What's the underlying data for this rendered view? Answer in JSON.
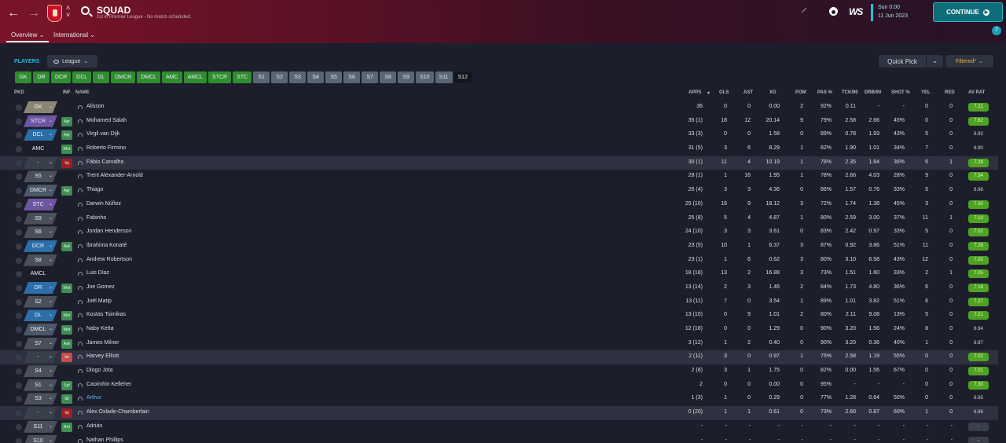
{
  "header": {
    "title": "SQUAD",
    "subtitle": "1st in Premier League - No match scheduled.",
    "tabs": [
      "Overview",
      "International"
    ],
    "date_time": "Sun 0:00",
    "date": "11 Jun 2023",
    "continue_label": "CONTINUE",
    "inbox_count": "7"
  },
  "toolbar": {
    "section_label": "PLAYERS",
    "view_label": "League",
    "quick_pick_label": "Quick Pick",
    "filter_label": "Filtered*"
  },
  "position_chips": [
    {
      "label": "GK",
      "state": "filled"
    },
    {
      "label": "DR",
      "state": "filled"
    },
    {
      "label": "DCR",
      "state": "filled"
    },
    {
      "label": "DCL",
      "state": "filled"
    },
    {
      "label": "DL",
      "state": "filled"
    },
    {
      "label": "DMCR",
      "state": "filled"
    },
    {
      "label": "DMCL",
      "state": "filled"
    },
    {
      "label": "AMC",
      "state": "filled"
    },
    {
      "label": "AMCL",
      "state": "filled"
    },
    {
      "label": "STCR",
      "state": "filled"
    },
    {
      "label": "STC",
      "state": "filled"
    },
    {
      "label": "S1",
      "state": "sub"
    },
    {
      "label": "S2",
      "state": "sub"
    },
    {
      "label": "S3",
      "state": "sub"
    },
    {
      "label": "S4",
      "state": "sub"
    },
    {
      "label": "S5",
      "state": "sub"
    },
    {
      "label": "S6",
      "state": "sub"
    },
    {
      "label": "S7",
      "state": "sub"
    },
    {
      "label": "S8",
      "state": "sub"
    },
    {
      "label": "S9",
      "state": "sub"
    },
    {
      "label": "S10",
      "state": "sub"
    },
    {
      "label": "S11",
      "state": "sub"
    },
    {
      "label": "S12",
      "state": "empty"
    }
  ],
  "columns": [
    "PKD",
    "INF",
    "NAME",
    "APPS",
    "GLS",
    "AST",
    "XG",
    "POM",
    "PAS %",
    "TCK/90",
    "DRB/90",
    "SHOT %",
    "YEL",
    "RED",
    "AV RAT"
  ],
  "players": [
    {
      "pos": "GK",
      "pos_style": "GK",
      "inf": "",
      "inf_style": "",
      "name": "Alisson",
      "apps": "36",
      "gls": "0",
      "ast": "0",
      "xg": "0.00",
      "pom": "2",
      "pas": "92%",
      "tck": "0.11",
      "drb": "-",
      "shot": "-",
      "yel": "0",
      "red": "0",
      "rat": "7.21",
      "rat_style": "hi",
      "hl": false,
      "link": false
    },
    {
      "pos": "STCR",
      "pos_style": "FWD",
      "inf": "Agr",
      "inf_style": "g",
      "name": "Mohamed Salah",
      "apps": "35 (1)",
      "gls": "18",
      "ast": "12",
      "xg": "20.14",
      "pom": "9",
      "pas": "79%",
      "tck": "2.58",
      "drb": "2.66",
      "shot": "45%",
      "yel": "0",
      "red": "0",
      "rat": "7.62",
      "rat_style": "hi",
      "hl": false,
      "link": false
    },
    {
      "pos": "DCL",
      "pos_style": "DEF",
      "inf": "Agr",
      "inf_style": "g",
      "name": "Virgil van Dijk",
      "apps": "33 (3)",
      "gls": "0",
      "ast": "0",
      "xg": "1.58",
      "pom": "0",
      "pas": "89%",
      "tck": "0.78",
      "drb": "1.93",
      "shot": "43%",
      "yel": "5",
      "red": "0",
      "rat": "6.92",
      "rat_style": "mid",
      "hl": false,
      "link": false
    },
    {
      "pos": "AMC",
      "pos_style": "AMCBLANK",
      "inf": "Wnt",
      "inf_style": "g",
      "name": "Roberto Firmino",
      "apps": "31 (5)",
      "gls": "3",
      "ast": "6",
      "xg": "8.29",
      "pom": "1",
      "pas": "82%",
      "tck": "1.90",
      "drb": "1.01",
      "shot": "34%",
      "yel": "7",
      "red": "0",
      "rat": "6.90",
      "rat_style": "mid",
      "hl": false,
      "link": false
    },
    {
      "pos": "-",
      "pos_style": "NONE",
      "inf": "Inj",
      "inf_style": "r",
      "name": "Fábio Carvalho",
      "apps": "30 (1)",
      "gls": "11",
      "ast": "4",
      "xg": "10.19",
      "pom": "1",
      "pas": "78%",
      "tck": "2.35",
      "drb": "1.84",
      "shot": "36%",
      "yel": "6",
      "red": "1",
      "rat": "7.28",
      "rat_style": "hi",
      "hl": true,
      "link": false
    },
    {
      "pos": "S5",
      "pos_style": "SUB",
      "inf": "",
      "inf_style": "",
      "name": "Trent Alexander-Arnold",
      "apps": "28 (1)",
      "gls": "1",
      "ast": "16",
      "xg": "1.95",
      "pom": "1",
      "pas": "78%",
      "tck": "2.66",
      "drb": "4.03",
      "shot": "28%",
      "yel": "9",
      "red": "0",
      "rat": "7.34",
      "rat_style": "hi",
      "hl": false,
      "link": false
    },
    {
      "pos": "DMCR",
      "pos_style": "DM",
      "inf": "Agr",
      "inf_style": "g",
      "name": "Thiago",
      "apps": "26 (4)",
      "gls": "3",
      "ast": "3",
      "xg": "4.36",
      "pom": "0",
      "pas": "86%",
      "tck": "1.57",
      "drb": "0.76",
      "shot": "33%",
      "yel": "5",
      "red": "0",
      "rat": "6.98",
      "rat_style": "mid",
      "hl": false,
      "link": false
    },
    {
      "pos": "STC",
      "pos_style": "FWD",
      "inf": "",
      "inf_style": "",
      "name": "Darwin Núñez",
      "apps": "25 (10)",
      "gls": "16",
      "ast": "9",
      "xg": "18.12",
      "pom": "3",
      "pas": "72%",
      "tck": "1.74",
      "drb": "1.38",
      "shot": "45%",
      "yel": "3",
      "red": "0",
      "rat": "7.30",
      "rat_style": "hi",
      "hl": false,
      "link": false
    },
    {
      "pos": "S9",
      "pos_style": "SUB",
      "inf": "",
      "inf_style": "",
      "name": "Fabinho",
      "apps": "25 (8)",
      "gls": "5",
      "ast": "4",
      "xg": "4.87",
      "pom": "1",
      "pas": "80%",
      "tck": "2.59",
      "drb": "3.00",
      "shot": "37%",
      "yel": "11",
      "red": "1",
      "rat": "7.10",
      "rat_style": "hi",
      "hl": false,
      "link": false
    },
    {
      "pos": "S6",
      "pos_style": "SUB",
      "inf": "",
      "inf_style": "",
      "name": "Jordan Henderson",
      "apps": "24 (10)",
      "gls": "3",
      "ast": "3",
      "xg": "3.61",
      "pom": "0",
      "pas": "83%",
      "tck": "2.42",
      "drb": "0.97",
      "shot": "33%",
      "yel": "5",
      "red": "0",
      "rat": "7.02",
      "rat_style": "hi",
      "hl": false,
      "link": false
    },
    {
      "pos": "DCR",
      "pos_style": "DEF",
      "inf": "Ask",
      "inf_style": "g",
      "name": "Ibrahima Konaté",
      "apps": "23 (5)",
      "gls": "10",
      "ast": "1",
      "xg": "6.37",
      "pom": "3",
      "pas": "87%",
      "tck": "0.92",
      "drb": "3.86",
      "shot": "51%",
      "yel": "11",
      "red": "0",
      "rat": "7.26",
      "rat_style": "hi",
      "hl": false,
      "link": false
    },
    {
      "pos": "S8",
      "pos_style": "SUB",
      "inf": "",
      "inf_style": "",
      "name": "Andrew Robertson",
      "apps": "23 (1)",
      "gls": "1",
      "ast": "6",
      "xg": "0.62",
      "pom": "3",
      "pas": "80%",
      "tck": "3.10",
      "drb": "6.58",
      "shot": "43%",
      "yel": "12",
      "red": "0",
      "rat": "7.20",
      "rat_style": "hi",
      "hl": false,
      "link": false
    },
    {
      "pos": "AMCL",
      "pos_style": "AMCBLANK",
      "inf": "",
      "inf_style": "",
      "name": "Luis Díaz",
      "apps": "18 (18)",
      "gls": "13",
      "ast": "2",
      "xg": "16.88",
      "pom": "3",
      "pas": "73%",
      "tck": "1.51",
      "drb": "1.60",
      "shot": "33%",
      "yel": "2",
      "red": "1",
      "rat": "7.05",
      "rat_style": "hi",
      "hl": false,
      "link": false
    },
    {
      "pos": "DR",
      "pos_style": "DEF",
      "inf": "Wnt",
      "inf_style": "g",
      "name": "Joe Gomez",
      "apps": "13 (14)",
      "gls": "2",
      "ast": "3",
      "xg": "1.46",
      "pom": "2",
      "pas": "84%",
      "tck": "1.73",
      "drb": "4.80",
      "shot": "36%",
      "yel": "6",
      "red": "0",
      "rat": "7.18",
      "rat_style": "hi",
      "hl": false,
      "link": false
    },
    {
      "pos": "S2",
      "pos_style": "SUB",
      "inf": "",
      "inf_style": "",
      "name": "Joël Matip",
      "apps": "13 (11)",
      "gls": "7",
      "ast": "0",
      "xg": "3.54",
      "pom": "1",
      "pas": "89%",
      "tck": "1.01",
      "drb": "3.82",
      "shot": "51%",
      "yel": "6",
      "red": "0",
      "rat": "7.27",
      "rat_style": "hi",
      "hl": false,
      "link": false
    },
    {
      "pos": "DL",
      "pos_style": "DEF",
      "inf": "Wnt",
      "inf_style": "g",
      "name": "Kostas Tsimikas",
      "apps": "13 (10)",
      "gls": "0",
      "ast": "9",
      "xg": "1.01",
      "pom": "2",
      "pas": "80%",
      "tck": "2.11",
      "drb": "9.08",
      "shot": "13%",
      "yel": "5",
      "red": "0",
      "rat": "7.21",
      "rat_style": "hi",
      "hl": false,
      "link": false
    },
    {
      "pos": "DMCL",
      "pos_style": "DM",
      "inf": "Wnt",
      "inf_style": "g",
      "name": "Naby Keïta",
      "apps": "12 (18)",
      "gls": "0",
      "ast": "0",
      "xg": "1.29",
      "pom": "0",
      "pas": "90%",
      "tck": "3.20",
      "drb": "1.56",
      "shot": "24%",
      "yel": "8",
      "red": "0",
      "rat": "6.94",
      "rat_style": "mid",
      "hl": false,
      "link": false
    },
    {
      "pos": "S7",
      "pos_style": "SUB",
      "inf": "Ask",
      "inf_style": "g",
      "name": "James Milner",
      "apps": "3 (12)",
      "gls": "1",
      "ast": "2",
      "xg": "0.40",
      "pom": "0",
      "pas": "90%",
      "tck": "3.20",
      "drb": "0.36",
      "shot": "40%",
      "yel": "1",
      "red": "0",
      "rat": "6.97",
      "rat_style": "mid",
      "hl": false,
      "link": false
    },
    {
      "pos": "-",
      "pos_style": "NONE",
      "inf": "Int",
      "inf_style": "lr",
      "name": "Harvey Elliott",
      "apps": "2 (11)",
      "gls": "3",
      "ast": "0",
      "xg": "0.97",
      "pom": "1",
      "pas": "75%",
      "tck": "2.58",
      "drb": "1.19",
      "shot": "55%",
      "yel": "0",
      "red": "0",
      "rat": "7.02",
      "rat_style": "hi",
      "hl": true,
      "link": false
    },
    {
      "pos": "S4",
      "pos_style": "SUB",
      "inf": "",
      "inf_style": "",
      "name": "Diogo Jota",
      "apps": "2 (8)",
      "gls": "3",
      "ast": "1",
      "xg": "1.75",
      "pom": "0",
      "pas": "82%",
      "tck": "0.00",
      "drb": "1.56",
      "shot": "67%",
      "yel": "0",
      "red": "0",
      "rat": "7.01",
      "rat_style": "hi",
      "hl": false,
      "link": false
    },
    {
      "pos": "S1",
      "pos_style": "SUB",
      "inf": "Spf",
      "inf_style": "g",
      "name": "Caoimhin Kelleher",
      "apps": "2",
      "gls": "0",
      "ast": "0",
      "xg": "0.00",
      "pom": "0",
      "pas": "95%",
      "tck": "-",
      "drb": "-",
      "shot": "-",
      "yel": "0",
      "red": "0",
      "rat": "7.30",
      "rat_style": "hi",
      "hl": false,
      "link": false
    },
    {
      "pos": "S3",
      "pos_style": "SUB",
      "inf": "Slt",
      "inf_style": "g",
      "name": "Arthur",
      "apps": "1 (3)",
      "gls": "1",
      "ast": "0",
      "xg": "0.29",
      "pom": "0",
      "pas": "77%",
      "tck": "1.28",
      "drb": "0.64",
      "shot": "50%",
      "yel": "0",
      "red": "0",
      "rat": "6.85",
      "rat_style": "mid",
      "hl": false,
      "link": true
    },
    {
      "pos": "-",
      "pos_style": "NONE",
      "inf": "Inj",
      "inf_style": "r",
      "name": "Alex Oxlade-Chamberlain",
      "apps": "0 (20)",
      "gls": "1",
      "ast": "1",
      "xg": "0.61",
      "pom": "0",
      "pas": "73%",
      "tck": "2.60",
      "drb": "0.87",
      "shot": "60%",
      "yel": "1",
      "red": "0",
      "rat": "6.96",
      "rat_style": "mid",
      "hl": true,
      "link": false
    },
    {
      "pos": "S11",
      "pos_style": "SUB",
      "inf": "Brd",
      "inf_style": "g",
      "name": "Adrián",
      "apps": "-",
      "gls": "-",
      "ast": "-",
      "xg": "-",
      "pom": "-",
      "pas": "-",
      "tck": "-",
      "drb": "-",
      "shot": "-",
      "yel": "-",
      "red": "-",
      "rat": "-",
      "rat_style": "none",
      "hl": false,
      "link": false
    },
    {
      "pos": "S10",
      "pos_style": "SUB",
      "inf": "",
      "inf_style": "",
      "name": "Nathan Phillips",
      "apps": "-",
      "gls": "-",
      "ast": "-",
      "xg": "-",
      "pom": "-",
      "pas": "-",
      "tck": "-",
      "drb": "-",
      "shot": "-",
      "yel": "-",
      "red": "-",
      "rat": "-",
      "rat_style": "none",
      "hl": false,
      "link": false
    }
  ]
}
